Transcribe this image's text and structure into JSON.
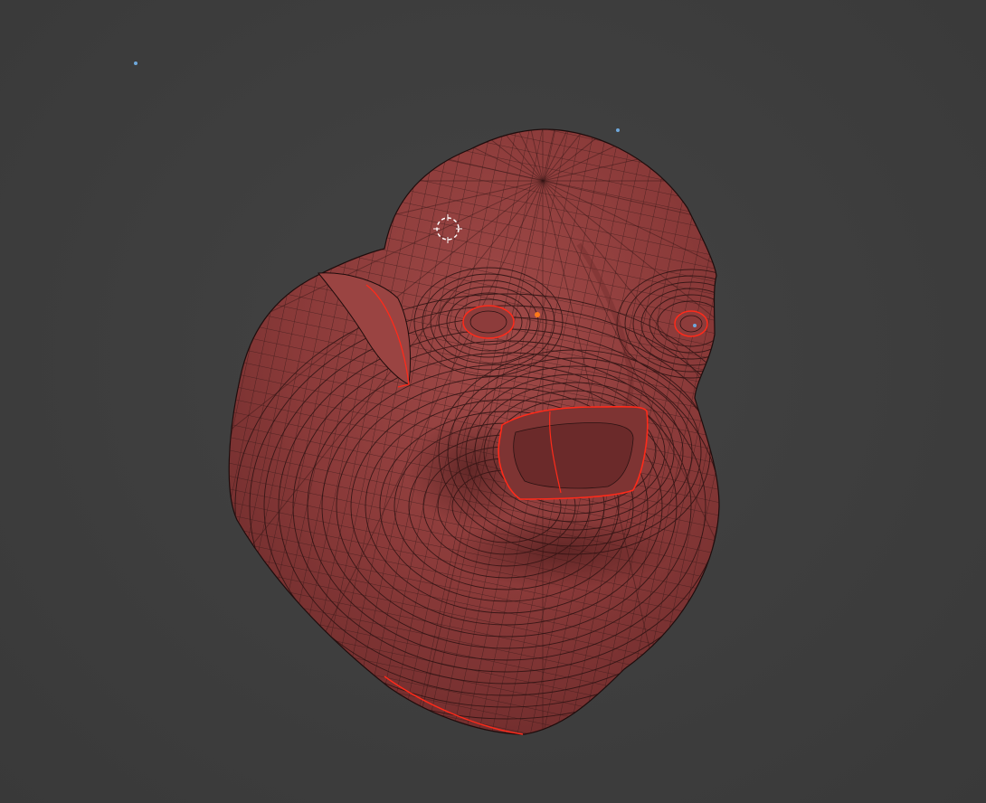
{
  "viewport": {
    "background_color": "#3d3d3d",
    "mesh_color": "#8a3b3b",
    "wire_color": "#2a1414",
    "selection_color": "#ff2a1a",
    "object_origin_color": "#ff7a1a",
    "light_color": "#6fa8dc"
  },
  "mesh": {
    "name": "",
    "mode": "edit",
    "shading": "solid-wireframe-overlay"
  },
  "icons": {
    "cursor": "3d-cursor-icon",
    "origin": "object-origin-icon",
    "light": "light-icon"
  }
}
